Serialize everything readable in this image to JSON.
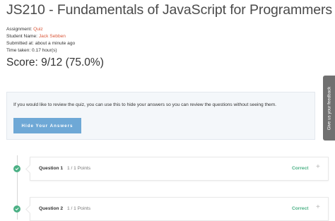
{
  "page": {
    "title": "JS210 - Fundamentals of JavaScript for Programmers"
  },
  "meta": {
    "assignment_label": "Assignment:",
    "assignment_value": "Quiz",
    "student_label": "Student Name:",
    "student_value": "Jack Sebben",
    "submitted_label": "Submitted at:",
    "submitted_value": "about a minute ago",
    "time_label": "Time taken:",
    "time_value": "0.17 hour(s)"
  },
  "score": "Score: 9/12 (75.0%)",
  "review": {
    "info_text": "If you would like to review the quiz, you can use this to hide your answers so you can review the questions without seeing them.",
    "hide_button_label": "Hide Your Answers"
  },
  "feedback_tab_label": "Give us your feedback",
  "questions": [
    {
      "label": "Question 1",
      "points": "1 / 1 Points",
      "status": "Correct",
      "expand_icon": "+"
    },
    {
      "label": "Question 2",
      "points": "1 / 1 Points",
      "status": "Correct",
      "expand_icon": "+"
    }
  ],
  "colors": {
    "accent_link": "#d9573a",
    "button": "#6ea8d6",
    "correct": "#4bb085",
    "feedback_tab": "#707070"
  }
}
